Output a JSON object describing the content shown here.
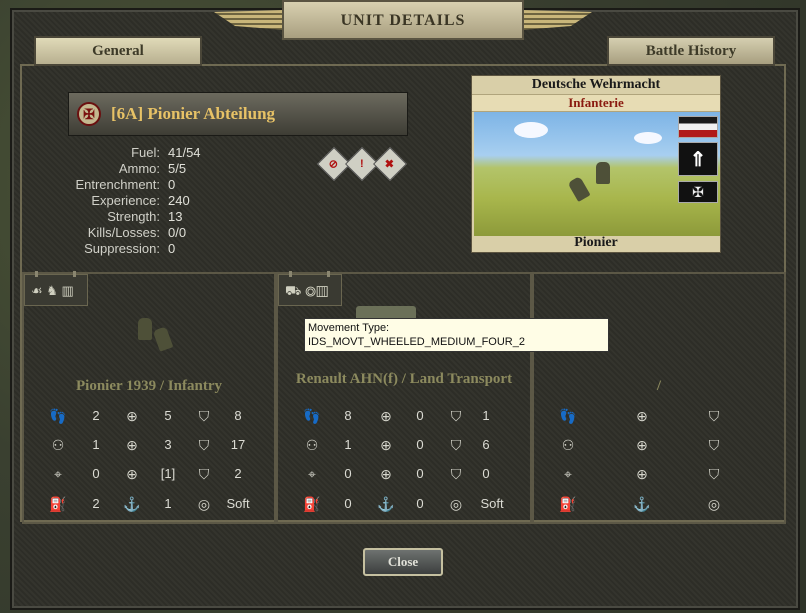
{
  "window": {
    "title": "UNIT DETAILS"
  },
  "tabs": {
    "general": "General",
    "history": "Battle History"
  },
  "unit": {
    "name": "[6A] Pionier Abteilung",
    "stats": [
      {
        "label": "Fuel:",
        "value": "41/54"
      },
      {
        "label": "Ammo:",
        "value": "5/5"
      },
      {
        "label": "Entrenchment:",
        "value": "0"
      },
      {
        "label": "Experience:",
        "value": "240"
      },
      {
        "label": "Strength:",
        "value": "13"
      },
      {
        "label": "Kills/Losses:",
        "value": "0/0"
      },
      {
        "label": "Suppression:",
        "value": "0"
      }
    ]
  },
  "card": {
    "nation": "Deutsche Wehrmacht",
    "branch": "Infanterie",
    "type": "Pionier"
  },
  "panels": [
    {
      "title": "Pionier 1939 / Infantry",
      "values": [
        "2",
        "5",
        "8",
        "1",
        "3",
        "17",
        "0",
        "[1]",
        "2",
        "2",
        "1",
        "Soft"
      ]
    },
    {
      "title": "Renault AHN(f) / Land Transport",
      "values": [
        "8",
        "0",
        "1",
        "1",
        "0",
        "6",
        "0",
        "0",
        "0",
        "0",
        "0",
        "Soft"
      ]
    },
    {
      "title": "/",
      "values": [
        "",
        "",
        "",
        "",
        "",
        "",
        "",
        "",
        "",
        "",
        "",
        ""
      ]
    }
  ],
  "tooltip": {
    "line1": "Movement Type:",
    "line2": "IDS_MOVT_WHEELED_MEDIUM_FOUR_2"
  },
  "buttons": {
    "close": "Close"
  },
  "colors": {
    "gold_text": "#e7c266",
    "panel_title": "#8c8a5e",
    "branch_red": "#8a1a10"
  }
}
